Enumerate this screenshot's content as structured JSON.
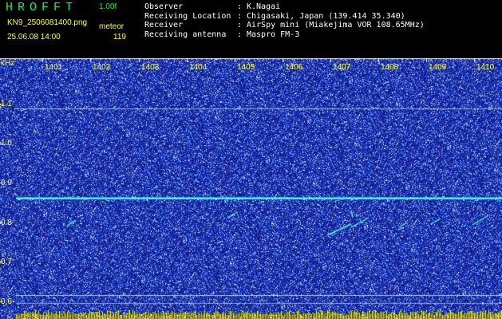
{
  "header": {
    "title": "HROFFT",
    "version": "1.00f",
    "file_name": "KN9_2506081400.png",
    "mode": "meteor",
    "timestamp": "25.06.08 14:00",
    "count": "119"
  },
  "info": [
    {
      "label": "Observer",
      "value": "K.Nagai"
    },
    {
      "label": "Receiving Location",
      "value": "Chigasaki, Japan (139.414 35.340)"
    },
    {
      "label": "Receiver",
      "value": "AirSpy mini (Miakejima VOR 108.65MHz)"
    },
    {
      "label": "Receiving antenna",
      "value": "Maspro FM-3"
    }
  ],
  "chart_data": {
    "type": "heatmap",
    "ylabel": "kHz",
    "y_ticks": [
      "1.1",
      "1.0",
      "0.9",
      "0.8",
      "0.7",
      "0.6"
    ],
    "x_ticks": [
      "1401",
      "1402",
      "1403",
      "1404",
      "1405",
      "1406",
      "1407",
      "1408",
      "1409",
      "1410"
    ],
    "colors": {
      "background": "#101a8c",
      "noise": "#3c78ff",
      "signal": "#33ffdd",
      "label": "#ffff33",
      "header_title": "#2ee65a"
    }
  }
}
